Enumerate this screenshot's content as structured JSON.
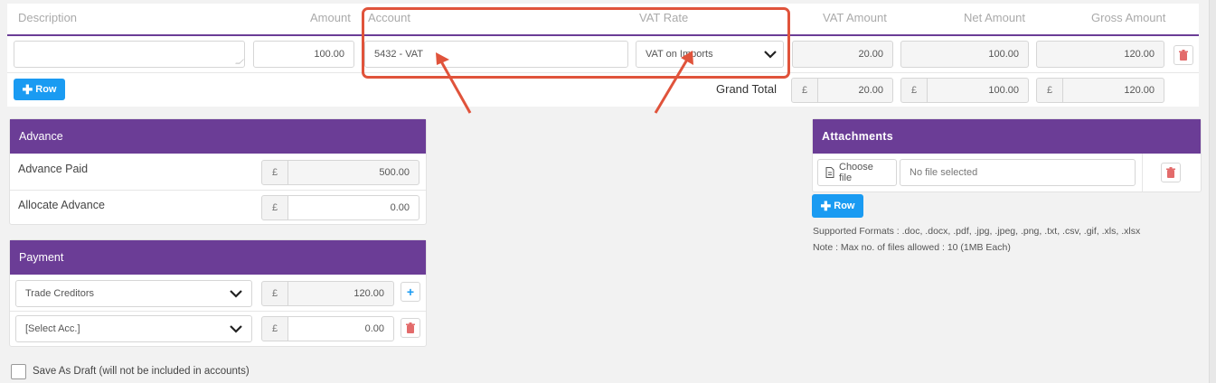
{
  "table": {
    "headers": {
      "description": "Description",
      "amount": "Amount",
      "account": "Account",
      "vat_rate": "VAT Rate",
      "vat_amount": "VAT Amount",
      "net_amount": "Net Amount",
      "gross_amount": "Gross Amount"
    },
    "row": {
      "description": "",
      "amount": "100.00",
      "account": "5432 - VAT",
      "vat_rate": "VAT on Imports",
      "vat_amount": "20.00",
      "net_amount": "100.00",
      "gross_amount": "120.00"
    },
    "add_row_label": "Row",
    "grand_total": {
      "label": "Grand Total",
      "currency": "£",
      "vat": "20.00",
      "net": "100.00",
      "gross": "120.00"
    }
  },
  "advance": {
    "title": "Advance",
    "paid_label": "Advance Paid",
    "paid_currency": "£",
    "paid_value": "500.00",
    "allocate_label": "Allocate Advance",
    "allocate_currency": "£",
    "allocate_value": "0.00"
  },
  "payment": {
    "title": "Payment",
    "rows": [
      {
        "account": "Trade Creditors",
        "currency": "£",
        "value": "120.00"
      },
      {
        "account": "[Select Acc.]",
        "currency": "£",
        "value": "0.00"
      }
    ]
  },
  "attachments": {
    "title": "Attachments",
    "choose_file_label": "Choose file",
    "no_file_text": "No file selected",
    "add_row_label": "Row",
    "supported_formats": "Supported Formats : .doc, .docx, .pdf, .jpg, .jpeg, .png, .txt, .csv, .gif, .xls, .xlsx",
    "note": "Note : Max no. of files allowed : 10 (1MB Each)"
  },
  "draft": {
    "label": "Save As Draft (will not be included in accounts)"
  },
  "colors": {
    "purple": "#6b3d96",
    "blue": "#1a9bf2",
    "highlight": "#e0533b",
    "delete": "#e36b6b"
  }
}
